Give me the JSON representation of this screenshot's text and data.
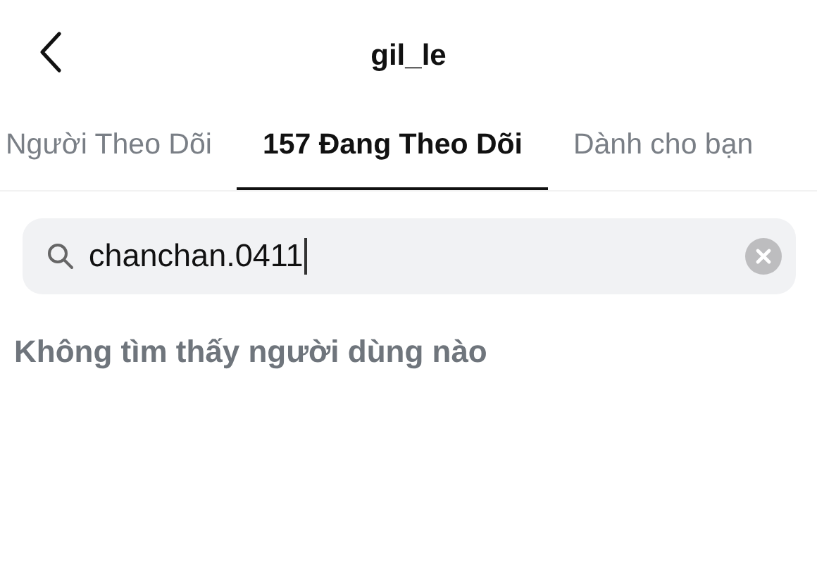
{
  "header": {
    "title": "gil_le"
  },
  "tabs": [
    {
      "label": "Người Theo Dõi",
      "selected": false
    },
    {
      "label": "157 Đang Theo Dõi",
      "selected": true
    },
    {
      "label": "Dành cho bạn",
      "selected": false
    }
  ],
  "search": {
    "value": "chanchan.0411"
  },
  "message": "Không tìm thấy người dùng nào"
}
